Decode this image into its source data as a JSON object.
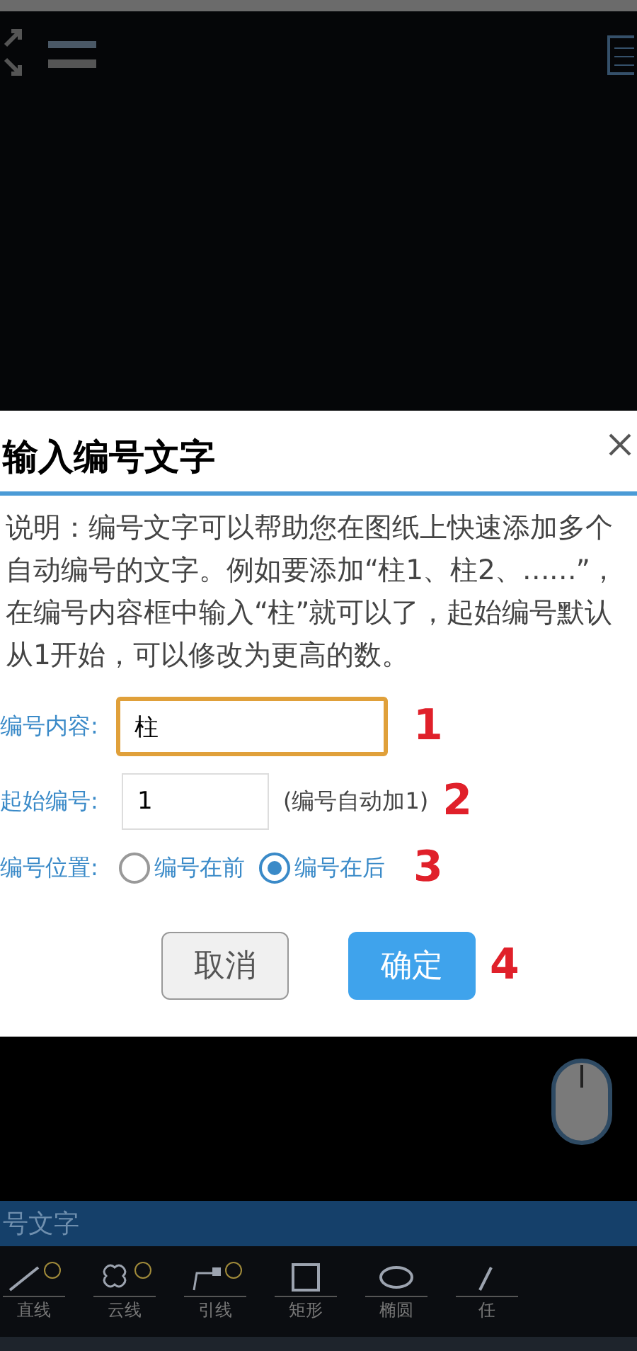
{
  "dialog": {
    "title": "输入编号文字",
    "description": "说明：编号文字可以帮助您在图纸上快速添加多个自动编号的文字。例如要添加“柱1、柱2、……”，在编号内容框中输入“柱”就可以了，起始编号默认从1开始，可以修改为更高的数。",
    "content_field": {
      "label": "编号内容:",
      "value": "柱",
      "annotation": "1"
    },
    "start_field": {
      "label": "起始编号:",
      "value": "1",
      "hint": "(编号自动加1)",
      "annotation": "2"
    },
    "position": {
      "label": "编号位置:",
      "annotation": "3",
      "options": [
        {
          "label": "编号在前",
          "selected": false
        },
        {
          "label": "编号在后",
          "selected": true
        }
      ]
    },
    "buttons": [
      {
        "label": "取消",
        "kind": "secondary"
      },
      {
        "label": "确定",
        "kind": "primary"
      }
    ],
    "buttons_annotation": "4"
  },
  "command_bar": {
    "text": "号文字"
  },
  "tools": [
    {
      "label": "直线",
      "kind": "line",
      "vip": true
    },
    {
      "label": "云线",
      "kind": "cloud",
      "vip": true
    },
    {
      "label": "引线",
      "kind": "leader",
      "vip": true
    },
    {
      "label": "矩形",
      "kind": "rect",
      "vip": false
    },
    {
      "label": "椭圆",
      "kind": "ellipse",
      "vip": false
    },
    {
      "label": "任",
      "kind": "other",
      "vip": false
    }
  ]
}
